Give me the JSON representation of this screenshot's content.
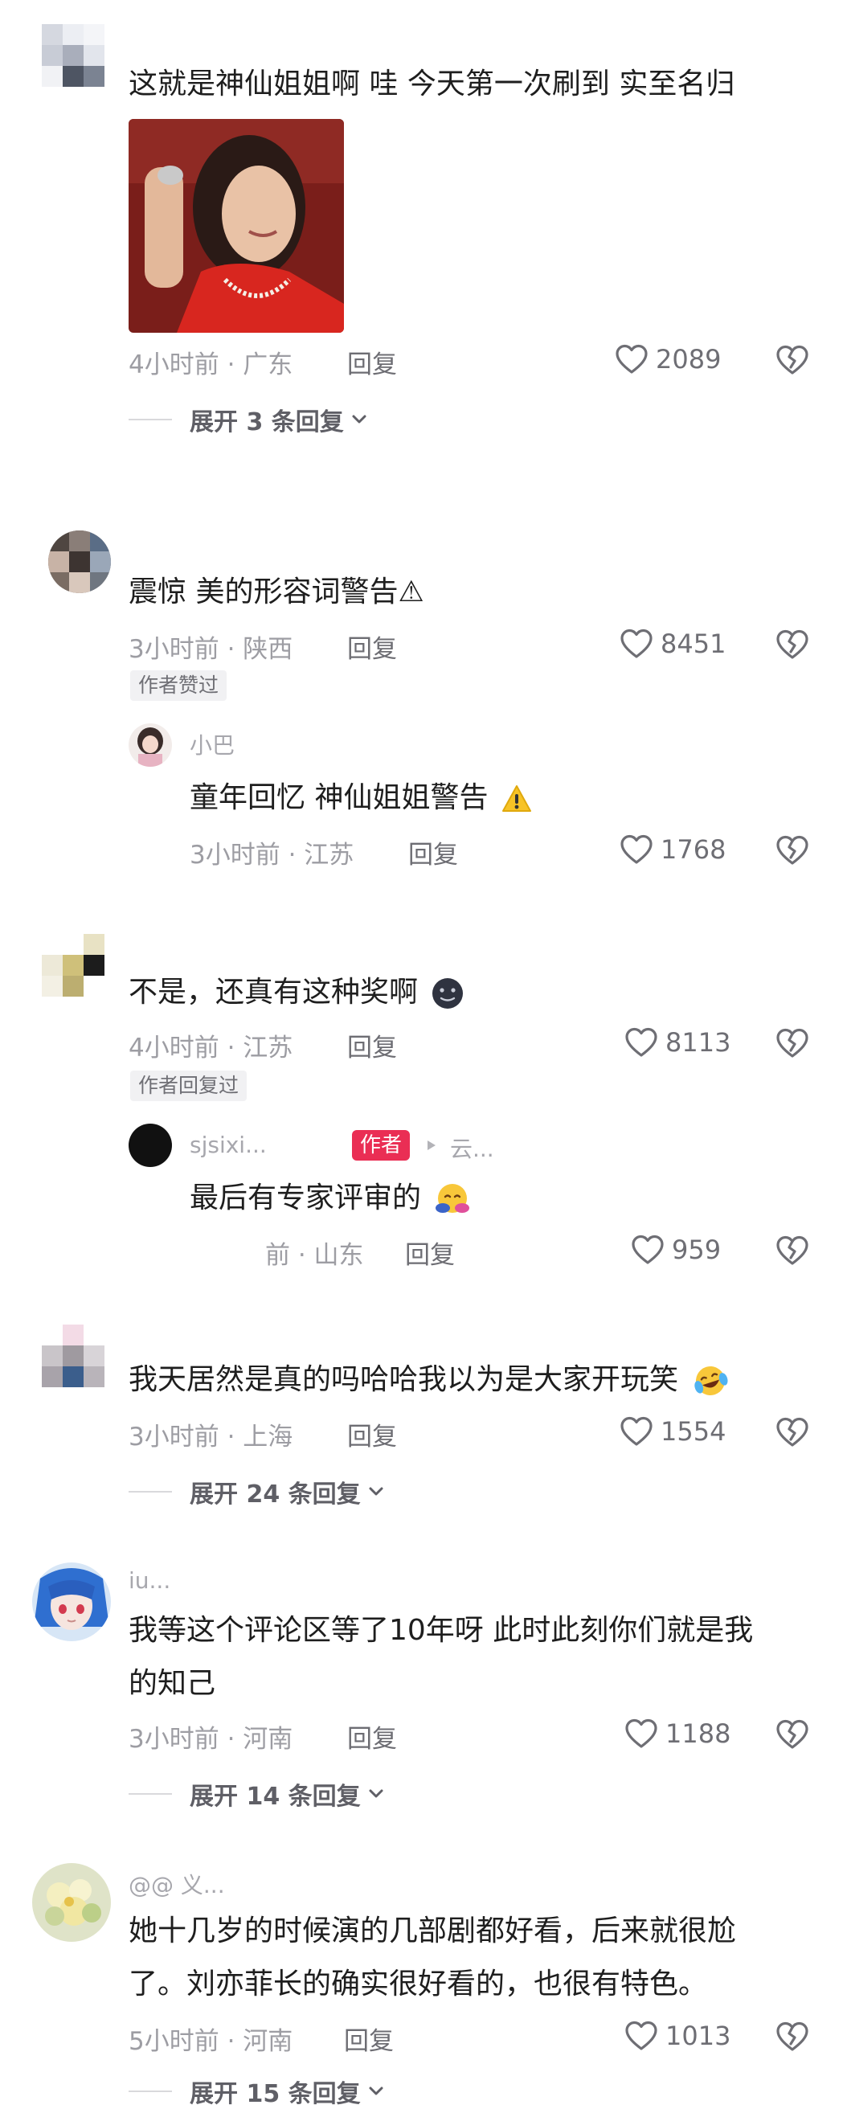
{
  "comments": [
    {
      "text": "这就是神仙姐姐啊 哇 今天第一次刷到 实至名归",
      "time_location": "4小时前 · 广东",
      "reply_label": "回复",
      "likes": "2089",
      "expand": "展开 3 条回复"
    },
    {
      "text": "震惊 美的形容词警告⚠",
      "time_location": "3小时前 · 陕西",
      "reply_label": "回复",
      "likes": "8451",
      "badge": "作者赞过",
      "replies": [
        {
          "username": "小巴",
          "text": "童年回忆 神仙姐姐警告",
          "time_location": "3小时前 · 江苏",
          "reply_label": "回复",
          "likes": "1768"
        }
      ]
    },
    {
      "text": "不是，还真有这种奖啊",
      "time_location": "4小时前 · 江苏",
      "reply_label": "回复",
      "likes": "8113",
      "badge": "作者回复过",
      "replies": [
        {
          "username": "sjsixi...",
          "author_tag": "作者",
          "reply_to": "云...",
          "text": "最后有专家评审的",
          "time_location": "前 · 山东",
          "reply_label": "回复",
          "likes": "959"
        }
      ]
    },
    {
      "text": "我天居然是真的吗哈哈我以为是大家开玩笑",
      "time_location": "3小时前 · 上海",
      "reply_label": "回复",
      "likes": "1554",
      "expand": "展开 24 条回复"
    },
    {
      "username": "iu...",
      "text_line1": "我等这个评论区等了10年呀 此时此刻你们就是我",
      "text_line2": "的知己",
      "time_location": "3小时前 · 河南",
      "reply_label": "回复",
      "likes": "1188",
      "expand": "展开 14 条回复"
    },
    {
      "username": "@@ 义...",
      "text_line1": "她十几岁的时候演的几部剧都好看，后来就很尬",
      "text_line2": "了。刘亦菲长的确实很好看的，也很有特色。",
      "time_location": "5小时前 · 河南",
      "reply_label": "回复",
      "likes": "1013",
      "expand": "展开 15 条回复"
    }
  ],
  "icons": {
    "like": "heart-outline-icon",
    "dislike": "broken-heart-icon",
    "expand": "chevron-down-icon",
    "warning": "warning-emoji-icon",
    "hug": "hug-emoji-icon",
    "laugh": "laugh-cry-emoji-icon",
    "grin": "dark-face-emoji-icon"
  },
  "colors": {
    "author_tag": "#ea2e54",
    "meta_text": "#9d9da3",
    "body_text": "#1e1e1e"
  }
}
